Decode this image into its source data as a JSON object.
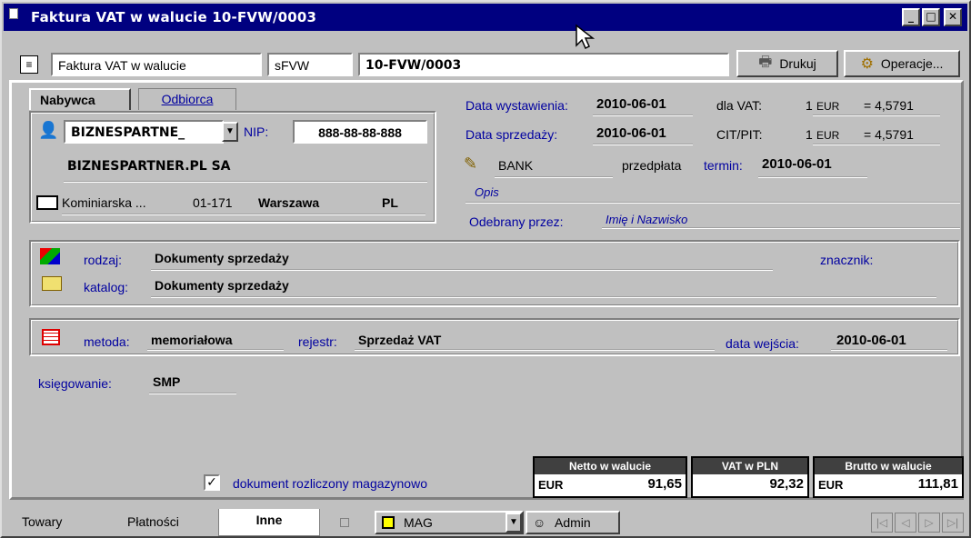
{
  "window": {
    "title": "Faktura VAT w walucie 10-FVW/0003",
    "minimize": "_",
    "maximize": "□",
    "close": "✕"
  },
  "header": {
    "doc_type": "Faktura VAT w walucie",
    "doc_code": "sFVW",
    "doc_number": "10-FVW/0003",
    "print_label": "Drukuj",
    "operations_label": "Operacje..."
  },
  "party_tabs": {
    "buyer": "Nabywca",
    "recipient": "Odbiorca"
  },
  "buyer": {
    "code": "BIZNESPARTNE_",
    "nip_label": "NIP:",
    "nip": "888-88-88-888",
    "name": "BIZNESPARTNER.PL SA",
    "street": "Kominiarska ...",
    "postal": "01-171",
    "city": "Warszawa",
    "country": "PL"
  },
  "dates": {
    "issue_label": "Data wystawienia:",
    "issue": "2010-06-01",
    "sale_label": "Data sprzedaży:",
    "sale": "2010-06-01",
    "vat_label": "dla VAT:",
    "vat_qty": "1",
    "vat_cur": "EUR",
    "vat_rate": "= 4,5791",
    "cit_label": "CIT/PIT:",
    "cit_qty": "1",
    "cit_cur": "EUR",
    "cit_rate": "= 4,5791"
  },
  "payment": {
    "method": "BANK",
    "type": "przedpłata",
    "due_label": "termin:",
    "due": "2010-06-01",
    "desc_placeholder": "Opis",
    "received_label": "Odebrany przez:",
    "received_placeholder": "Imię i Nazwisko"
  },
  "classification": {
    "kind_label": "rodzaj:",
    "kind": "Dokumenty sprzedaży",
    "catalog_label": "katalog:",
    "catalog": "Dokumenty sprzedaży",
    "marker_label": "znacznik:"
  },
  "register": {
    "method_label": "metoda:",
    "method": "memoriałowa",
    "register_label": "rejestr:",
    "register": "Sprzedaż VAT",
    "entry_date_label": "data wejścia:",
    "entry_date": "2010-06-01"
  },
  "posting": {
    "label": "księgowanie:",
    "value": "SMP"
  },
  "warehouse_checkbox": {
    "label": "dokument rozliczony magazynowo",
    "checked": true
  },
  "totals": {
    "net_title": "Netto w walucie",
    "net_currency": "EUR",
    "net_value": "91,65",
    "vat_title": "VAT w PLN",
    "vat_value": "92,32",
    "gross_title": "Brutto w walucie",
    "gross_currency": "EUR",
    "gross_value": "111,81"
  },
  "bottom_tabs": {
    "goods": "Towary",
    "payments": "Płatności",
    "other": "Inne"
  },
  "status": {
    "warehouse": "MAG",
    "user": "Admin"
  },
  "nav": {
    "first": "|◁",
    "prev": "◁",
    "next": "▷",
    "last": "▷|"
  }
}
